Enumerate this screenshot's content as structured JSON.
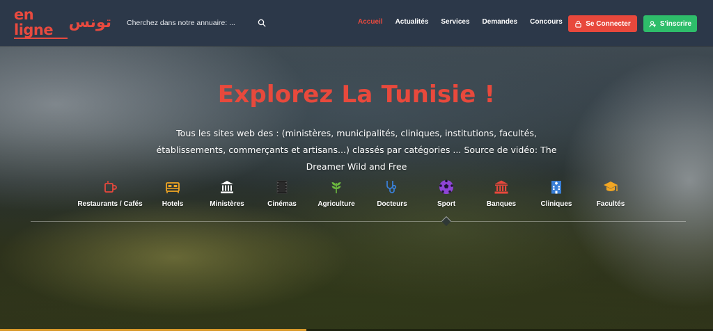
{
  "header": {
    "logo": {
      "latin": "en ligne",
      "arabic": "تونس"
    },
    "search": {
      "placeholder": "Cherchez dans notre annuaire: ..."
    },
    "nav": [
      {
        "label": "Accueil",
        "active": true
      },
      {
        "label": "Actualités",
        "active": false
      },
      {
        "label": "Services",
        "active": false
      },
      {
        "label": "Demandes",
        "active": false
      },
      {
        "label": "Concours",
        "active": false
      }
    ],
    "login_label": "Se Connecter",
    "signup_label": "S'inscrire"
  },
  "hero": {
    "title": "Explorez La Tunisie !",
    "description": "Tous les sites web des : (ministères, municipalités, cliniques, institutions, facultés, établissements, commerçants et artisans...) classés par catégories ... Source de vidéo: The Dreamer Wild and Free"
  },
  "categories": [
    {
      "label": "Restaurants / Cafés",
      "icon": "coffee-cup-icon",
      "color": "#e8483c"
    },
    {
      "label": "Hotels",
      "icon": "bed-icon",
      "color": "#f2a623"
    },
    {
      "label": "Ministères",
      "icon": "government-building-icon",
      "color": "#ffffff"
    },
    {
      "label": "Cinémas",
      "icon": "film-icon",
      "color": "#1b1b1b"
    },
    {
      "label": "Agriculture",
      "icon": "leaf-icon",
      "color": "#6dbb3f"
    },
    {
      "label": "Docteurs",
      "icon": "stethoscope-icon",
      "color": "#3a7fd6"
    },
    {
      "label": "Sport",
      "icon": "soccer-ball-icon",
      "color": "#8e44d6",
      "active": true
    },
    {
      "label": "Banques",
      "icon": "bank-icon",
      "color": "#e8483c"
    },
    {
      "label": "Cliniques",
      "icon": "hospital-icon",
      "color": "#3a7fd6"
    },
    {
      "label": "Facultés",
      "icon": "graduation-cap-icon",
      "color": "#f2a623"
    }
  ],
  "colors": {
    "accent": "#e8493c",
    "header_bg": "#2c3849",
    "signup": "#2ebd6a"
  },
  "video": {
    "progress": 0.43
  }
}
